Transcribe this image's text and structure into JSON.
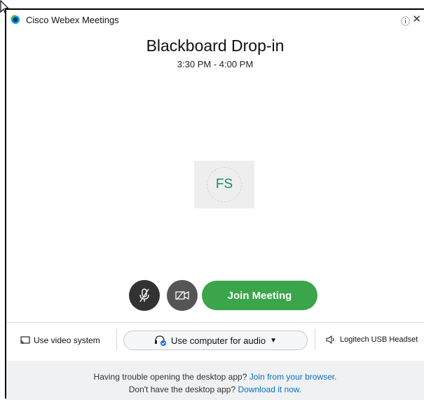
{
  "app": {
    "title": "Cisco Webex Meetings"
  },
  "meeting": {
    "title": "Blackboard Drop-in",
    "time": "3:30 PM - 4:00 PM"
  },
  "avatar": {
    "initials": "FS"
  },
  "controls": {
    "join_label": "Join Meeting"
  },
  "bottombar": {
    "video_system_label": "Use video system",
    "audio_label": "Use computer for audio",
    "headset_label": "Logitech USB Headset"
  },
  "footer": {
    "line1_text": "Having trouble opening the desktop app?",
    "line1_link": "Join from your browser.",
    "line2_text": "Don't have the desktop app?",
    "line2_link": "Download it now."
  },
  "colors": {
    "join_green": "#3aa54a",
    "link_blue": "#0a6fc2",
    "avatar_teal": "#1a8a6a"
  }
}
